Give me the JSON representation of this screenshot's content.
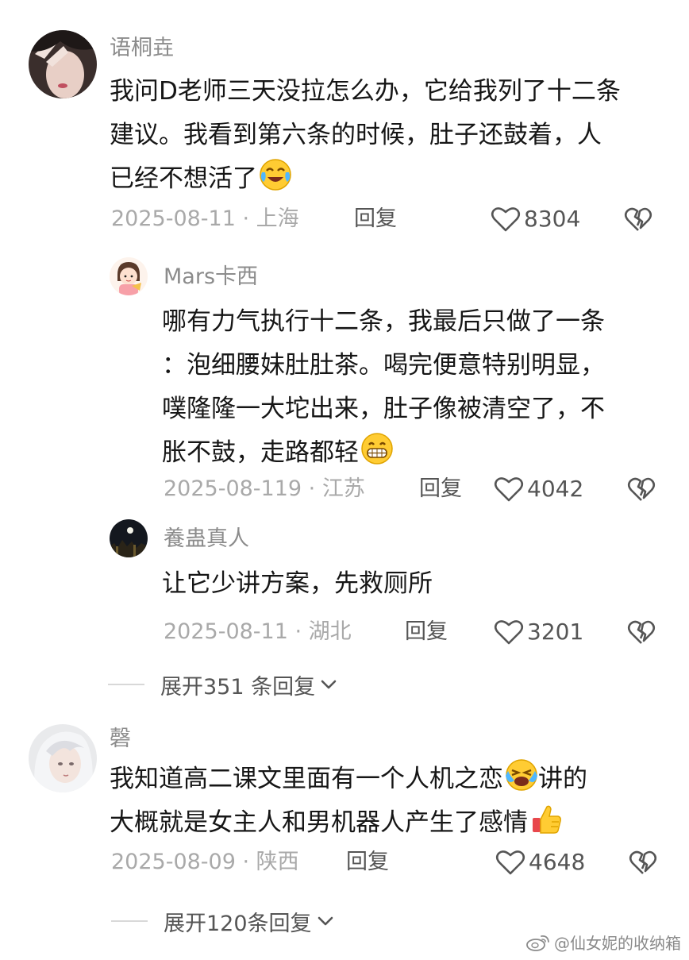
{
  "comments": [
    {
      "user": "语桐垚",
      "lines": [
        "我问D老师三天没拉怎么办，它给我列了十二条",
        "建议。我看到第六条的时候，肚子还鼓着，人",
        "已经不想活了"
      ],
      "emoji": "crying-laugh-emoji",
      "date": "2025-08-11 · 上海",
      "reply_label": "回复",
      "likes": "8304",
      "replies": [
        {
          "user": "Mars卡西",
          "lines": [
            "哪有力气执行十二条，我最后只做了一条",
            "：泡细腰妹肚肚茶。喝完便意特别明显，",
            "噗隆隆一大坨出来，肚子像被清空了，不",
            "胀不鼓，走路都轻"
          ],
          "emoji": "grinning-emoji",
          "date": "2025-08-119 · 江苏",
          "reply_label": "回复",
          "likes": "4042"
        },
        {
          "user": "養蛊真人",
          "lines": [
            "让它少讲方案，先救厕所"
          ],
          "date": "2025-08-11 · 湖北",
          "reply_label": "回复",
          "likes": "3201"
        }
      ],
      "expand_label": "展开351 条回复"
    },
    {
      "user": "磬",
      "lines": [
        "我知道高二课文里面有一个人机之恋",
        "大概就是女主人和男机器人产生了感情"
      ],
      "line1_tail": "讲的",
      "emojis": [
        "loudly-crying-laugh-emoji",
        "thumbs-up-emoji"
      ],
      "date": "2025-08-09 · 陕西",
      "reply_label": "回复",
      "likes": "4648",
      "expand_label": "展开120条回复"
    }
  ],
  "watermark": "@仙女妮的收纳箱",
  "icons": [
    "heart-outline-icon",
    "broken-heart-icon",
    "chevron-down-icon",
    "weibo-logo-icon"
  ]
}
